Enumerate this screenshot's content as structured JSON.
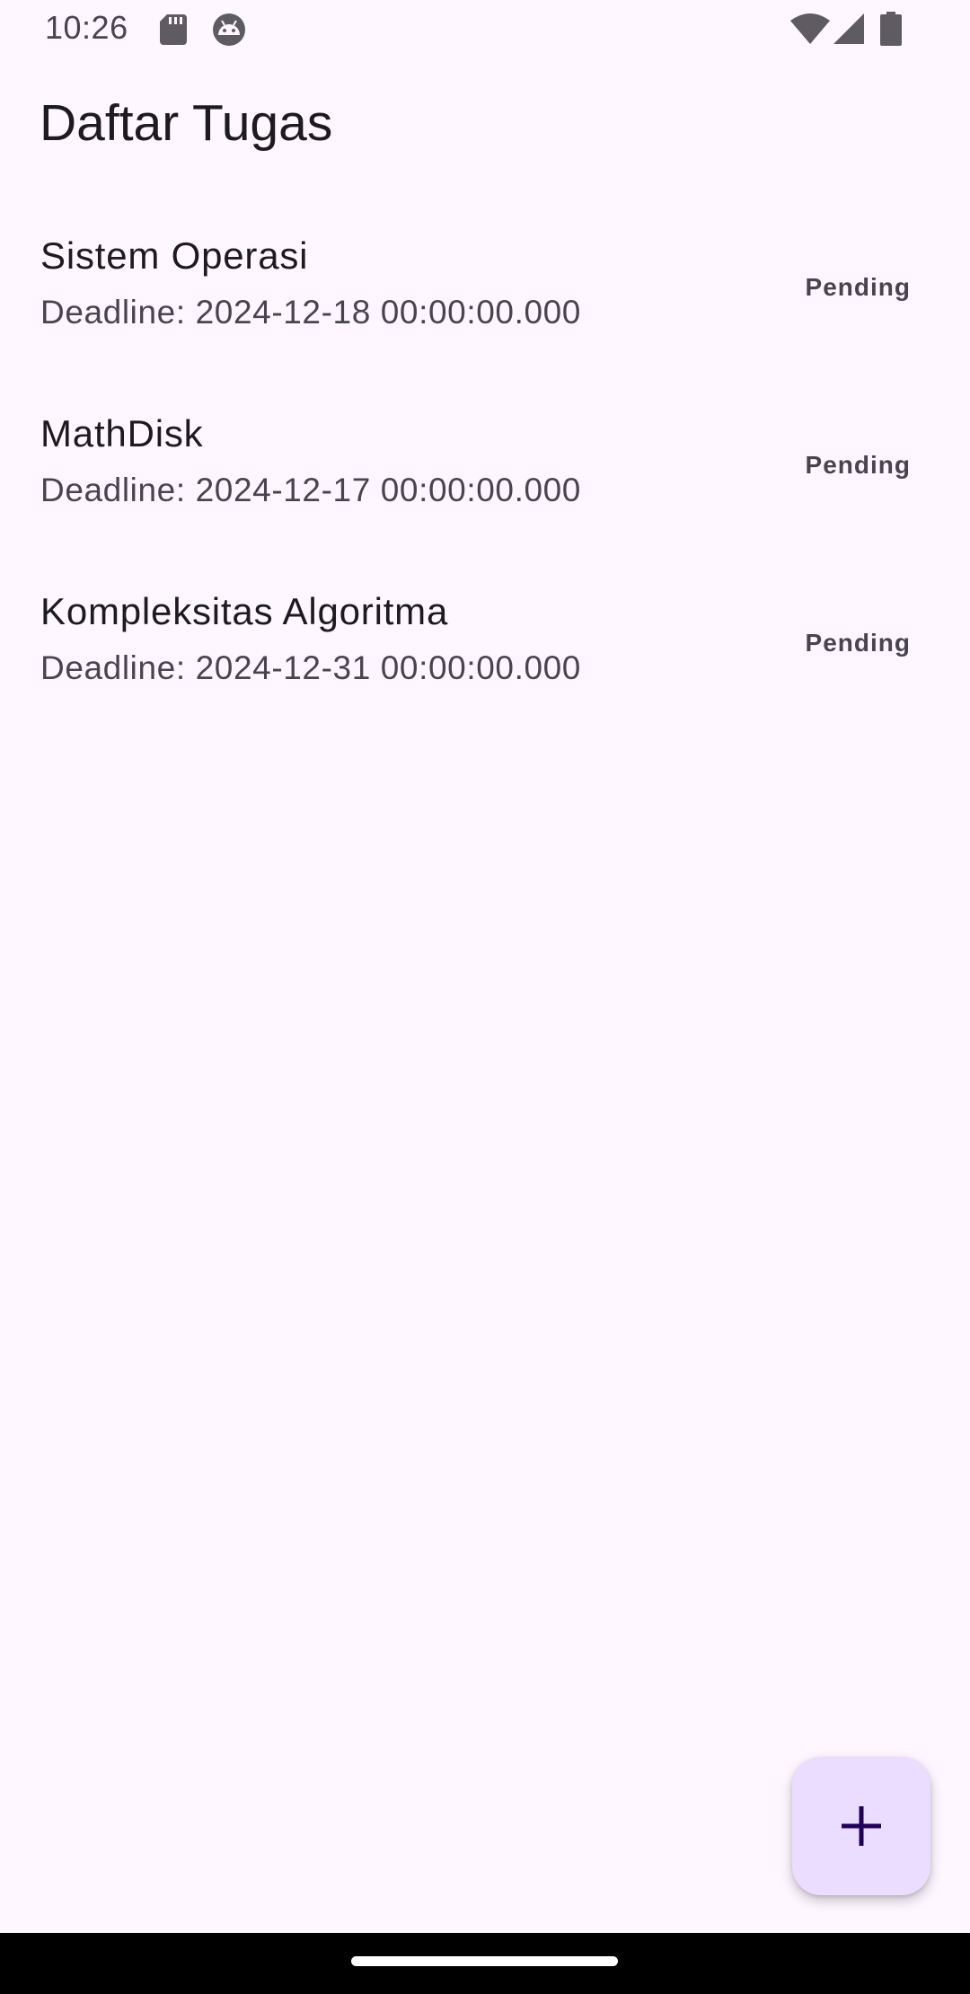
{
  "status_bar": {
    "time": "10:26",
    "icons": [
      "sd-card-icon",
      "android-debug-icon",
      "wifi-icon",
      "cellular-signal-icon",
      "battery-icon"
    ]
  },
  "app_bar": {
    "title": "Daftar Tugas"
  },
  "tasks": [
    {
      "title": "Sistem Operasi",
      "deadline": "Deadline: 2024-12-18 00:00:00.000",
      "status": "Pending"
    },
    {
      "title": "MathDisk",
      "deadline": "Deadline: 2024-12-17 00:00:00.000",
      "status": "Pending"
    },
    {
      "title": "Kompleksitas Algoritma",
      "deadline": "Deadline: 2024-12-31 00:00:00.000",
      "status": "Pending"
    }
  ],
  "fab": {
    "icon": "add-icon"
  },
  "colors": {
    "background": "#fef7ff",
    "on_surface": "#1d1b20",
    "on_surface_variant": "#49454f",
    "fab_container": "#eaddff",
    "fab_icon": "#21005d"
  }
}
